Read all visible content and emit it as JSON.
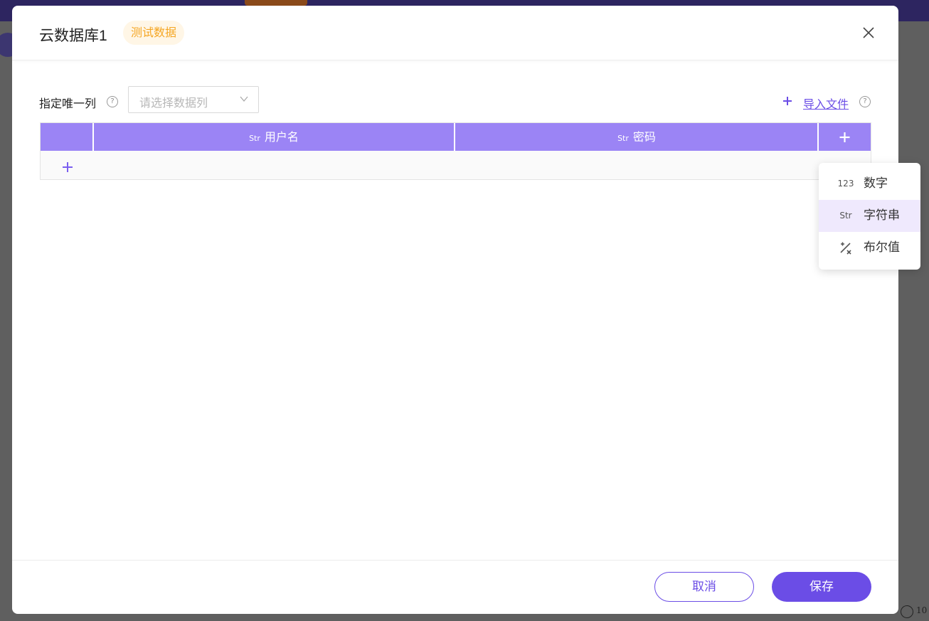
{
  "dialog": {
    "title": "云数据库1",
    "tag": "测试数据",
    "close_label": "×"
  },
  "unique_column": {
    "label": "指定唯一列",
    "help": "?",
    "placeholder": "请选择数据列"
  },
  "import": {
    "label": "导入文件",
    "help": "?"
  },
  "table": {
    "columns": [
      {
        "type": "Str",
        "name": "用户名"
      },
      {
        "type": "Str",
        "name": "密码"
      }
    ]
  },
  "type_menu": {
    "items": [
      {
        "icon": "123",
        "label": "数字"
      },
      {
        "icon": "Str",
        "label": "字符串"
      },
      {
        "icon": "percent-icon",
        "label": "布尔值"
      }
    ],
    "active_index": 1
  },
  "footer": {
    "cancel_label": "取消",
    "save_label": "保存"
  },
  "background": {
    "zoom_text": "10"
  },
  "colors": {
    "primary": "#6b4de6",
    "header_bg": "#9b84f5",
    "tag_bg": "#fff6e6",
    "tag_text": "#f5a623"
  }
}
